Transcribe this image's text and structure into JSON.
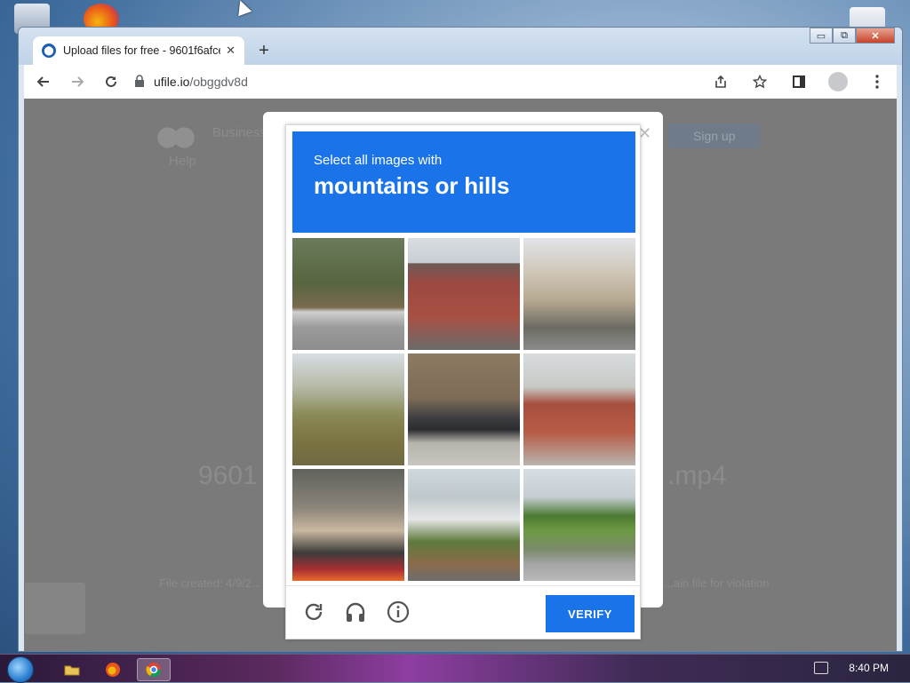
{
  "browser": {
    "tab_title": "Upload files for free - 9601f6afce",
    "tab_close": "✕",
    "new_tab": "+",
    "url_host": "ufile.io",
    "url_path": "/obggdv8d",
    "window_controls": [
      "▭",
      "⧉",
      "✕"
    ]
  },
  "captcha": {
    "prompt": "Select all images with",
    "target": "mountains or hills",
    "verify_label": "VERIFY",
    "colors": {
      "accent": "#1a73e8"
    },
    "tiles": [
      {
        "id": "tile-1"
      },
      {
        "id": "tile-2"
      },
      {
        "id": "tile-3"
      },
      {
        "id": "tile-4"
      },
      {
        "id": "tile-5"
      },
      {
        "id": "tile-6"
      },
      {
        "id": "tile-7"
      },
      {
        "id": "tile-8"
      },
      {
        "id": "tile-9"
      }
    ],
    "footer_icons": [
      "reload-icon",
      "headphones-icon",
      "info-icon"
    ]
  },
  "page_background": {
    "nav_business": "Business",
    "nav_help": "Help",
    "nav_signup": "Sign up",
    "filename_fragment_left": "9601",
    "filename_fragment_right": ".mp4",
    "footer_left": "File created: 4/9/2...",
    "footer_right": "...ain file for violation"
  },
  "taskbar": {
    "clock": "8:40 PM"
  }
}
